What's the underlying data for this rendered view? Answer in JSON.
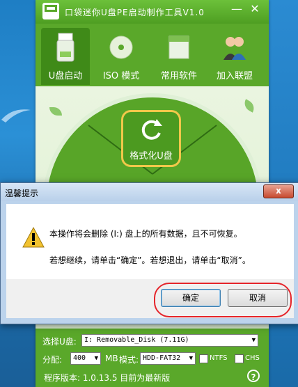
{
  "app": {
    "title": "口袋迷你U盘PE启动制作工具V1.0",
    "logo_text": "口袋PE",
    "minimize_label": "—",
    "close_label": "✕",
    "nav": [
      {
        "label": "U盘启动",
        "icon": "usb-drive-icon",
        "active": true
      },
      {
        "label": "ISO 模式",
        "icon": "disc-icon",
        "active": false
      },
      {
        "label": "常用软件",
        "icon": "software-box-icon",
        "active": false
      },
      {
        "label": "加入联盟",
        "icon": "people-icon",
        "active": false
      }
    ],
    "format_button_label": "格式化U盘",
    "select_label": "选择U盘:",
    "drive_value": "I: Removable_Disk (7.11G)",
    "alloc_label": "分配:",
    "alloc_value": "400",
    "unit_label": "MB",
    "mode_label": "模式:",
    "mode_value": "HDD-FAT32",
    "ntfs_label": "NTFS",
    "chs_label": "CHS",
    "version_text": "程序版本: 1.0.13.5 目前为最新版",
    "help_icon": "?"
  },
  "dialog": {
    "title": "温馨提示",
    "close_label": "x",
    "line1": "本操作将会删除 (I:) 盘上的所有数据，且不可恢复。",
    "line2": "若想继续，请单击“确定”。若想退出，请单击“取消”。",
    "ok_label": "确定",
    "cancel_label": "取消"
  },
  "colors": {
    "app_green": "#5aa82a",
    "highlight": "#e5242a",
    "format_border": "#f1c84a"
  }
}
